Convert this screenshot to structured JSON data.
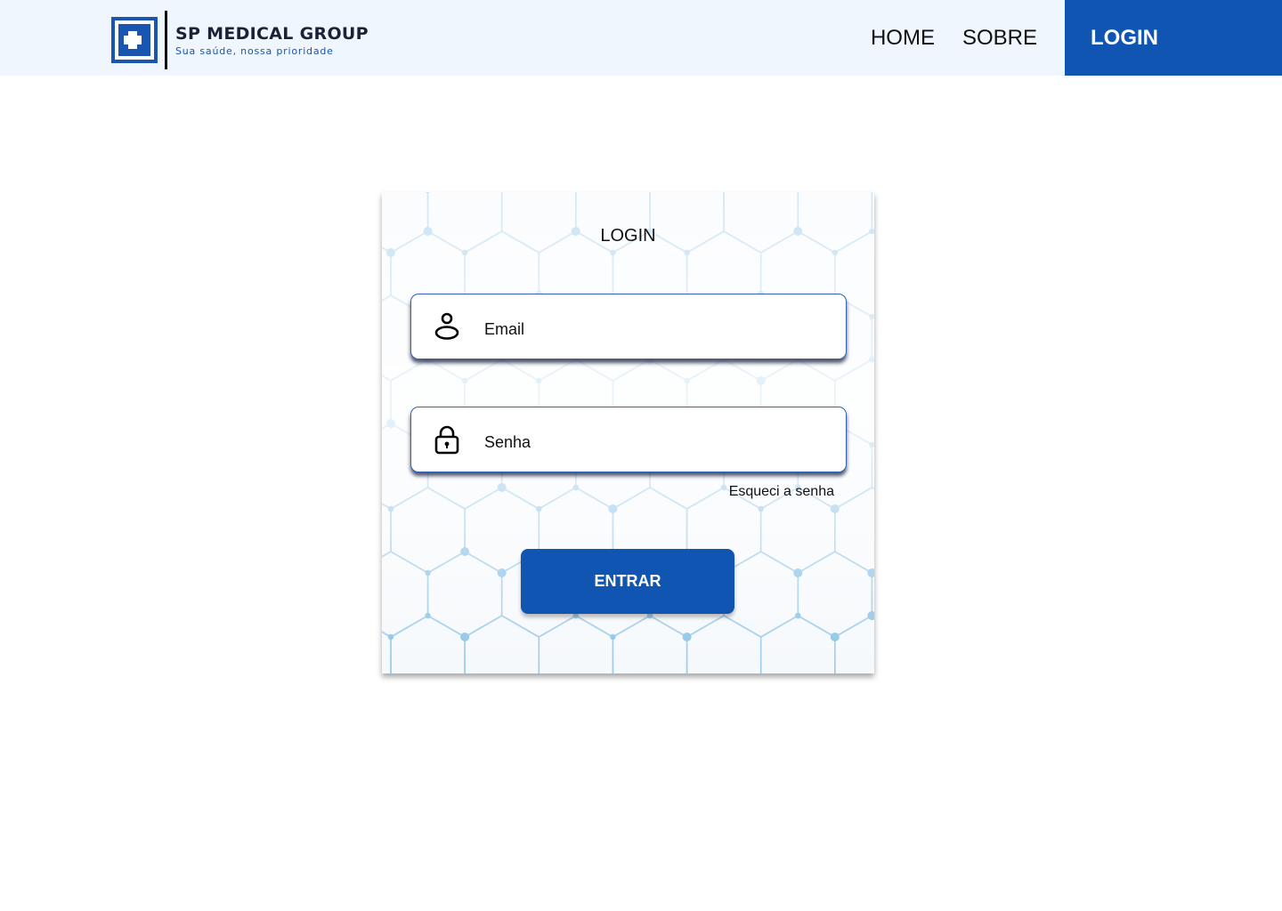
{
  "header": {
    "brand_name": "SP MEDICAL GROUP",
    "brand_tagline": "Sua saúde, nossa prioridade",
    "nav": {
      "home": "HOME",
      "sobre": "SOBRE",
      "login": "LOGIN"
    }
  },
  "login_card": {
    "title": "LOGIN",
    "email_placeholder": "Email",
    "password_placeholder": "Senha",
    "forgot_password": "Esqueci a senha",
    "submit_label": "ENTRAR"
  },
  "icons": {
    "logo": "medical-cross-icon",
    "email": "user-icon",
    "password": "lock-icon"
  },
  "colors": {
    "primary": "#1155b2",
    "header_bg": "#eff6fe",
    "field_border": "#3562b8",
    "hex_pattern": "#8cc3e6"
  }
}
